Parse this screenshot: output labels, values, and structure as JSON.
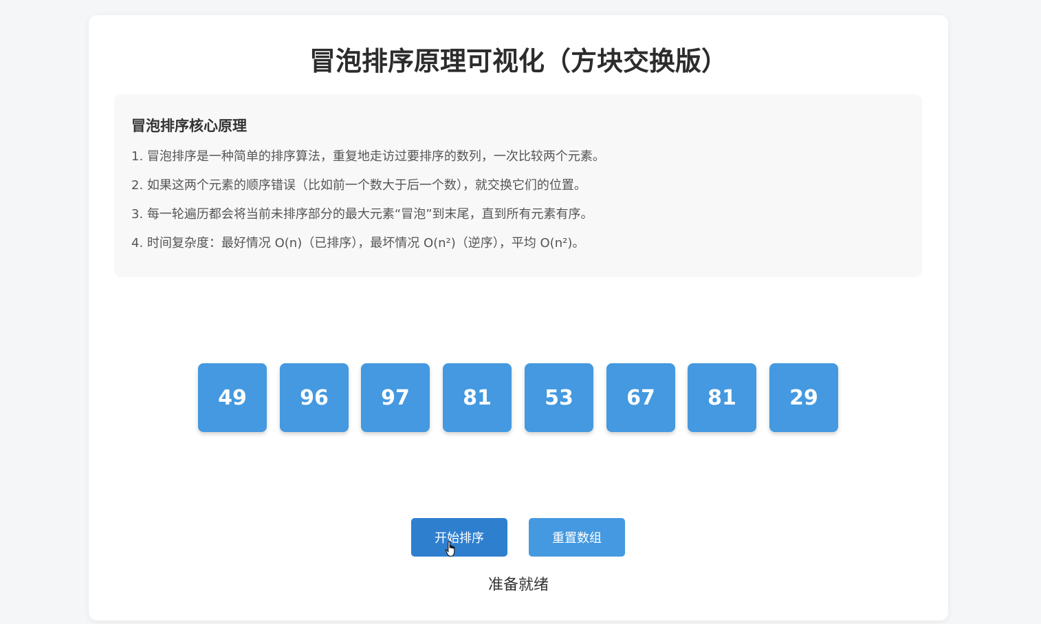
{
  "title": "冒泡排序原理可视化（方块交换版）",
  "info": {
    "heading": "冒泡排序核心原理",
    "lines": [
      "1. 冒泡排序是一种简单的排序算法，重复地走访过要排序的数列，一次比较两个元素。",
      "2. 如果这两个元素的顺序错误（比如前一个数大于后一个数），就交换它们的位置。",
      "3. 每一轮遍历都会将当前未排序部分的最大元素“冒泡”到末尾，直到所有元素有序。",
      "4. 时间复杂度：最好情况 O(n)（已排序），最坏情况 O(n²)（逆序），平均 O(n²)。"
    ]
  },
  "array": [
    "49",
    "96",
    "97",
    "81",
    "53",
    "67",
    "81",
    "29"
  ],
  "buttons": {
    "start_label": "开始排序",
    "reset_label": "重置数组"
  },
  "status": "准备就绪",
  "colors": {
    "block": "#4499e0",
    "start_button": "#2f7fcf",
    "reset_button": "#4499e0"
  }
}
